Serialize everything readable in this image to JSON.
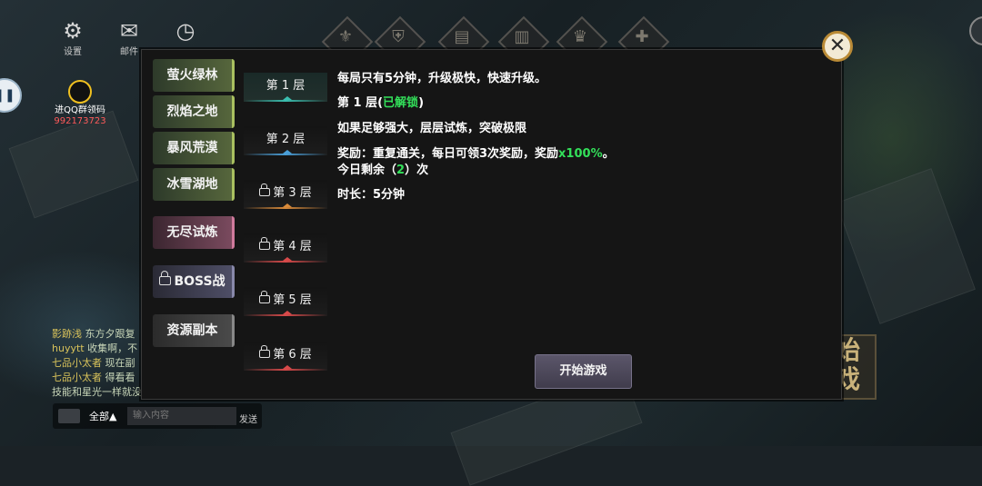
{
  "top_bar": {
    "settings_label": "设置",
    "mail_label": "邮件"
  },
  "qq": {
    "label": "进QQ群领码",
    "number": "992173723"
  },
  "chat": {
    "lines": [
      {
        "name": "影跡浅",
        "text": "东方夕跟复"
      },
      {
        "name": "huyytt",
        "text": "收集啊，不"
      },
      {
        "name": "七品小太者",
        "text": "现在副"
      },
      {
        "name": "七品小太者",
        "text": "得看看"
      },
      {
        "name": "",
        "text": "技能和星光一样就没"
      }
    ],
    "channel": "全部▲",
    "input_placeholder": "输入内容",
    "send_label": "发送"
  },
  "background_button": {
    "label_line1": "始",
    "label_line2": "戏"
  },
  "categories": [
    {
      "label": "萤火绿林",
      "style": "green",
      "locked": false
    },
    {
      "label": "烈焰之地",
      "style": "green",
      "locked": false
    },
    {
      "label": "暴风荒漠",
      "style": "green",
      "locked": false
    },
    {
      "label": "冰雪湖地",
      "style": "green",
      "locked": false
    },
    {
      "label": "无尽试炼",
      "style": "pink",
      "locked": false
    },
    {
      "label": "BOSS战",
      "style": "lock-purple",
      "locked": true
    },
    {
      "label": "资源副本",
      "style": "gray",
      "locked": false
    }
  ],
  "levels": [
    {
      "label": "第 1 层",
      "color": "teal",
      "locked": false,
      "active": true
    },
    {
      "label": "第 2 层",
      "color": "blue",
      "locked": false,
      "active": false
    },
    {
      "label": "第 3 层",
      "color": "orange",
      "locked": true,
      "active": false
    },
    {
      "label": "第 4 层",
      "color": "red",
      "locked": true,
      "active": false
    },
    {
      "label": "第 5 层",
      "color": "red",
      "locked": true,
      "active": false
    },
    {
      "label": "第 6 层",
      "color": "red",
      "locked": true,
      "active": false
    }
  ],
  "info": {
    "intro": "每局只有5分钟，升级极快，快速升级。",
    "level_title": "第 1 层(",
    "unlocked_status": "已解锁",
    "level_title_end": ")",
    "description": "如果足够强大，层层试炼，突破极限",
    "reward_prefix": "奖励：重复通关，每日可领3次奖励，奖励",
    "reward_multiplier": "x100%",
    "reward_suffix": "。",
    "remaining_prefix": "今日剩余（",
    "remaining_count": "2",
    "remaining_suffix": "）次",
    "duration": "时长：5分钟"
  },
  "start_button": "开始游戏",
  "close_symbol": "✕",
  "colors": {
    "green_text": "#33e05a",
    "close_border": "#b98a36"
  }
}
